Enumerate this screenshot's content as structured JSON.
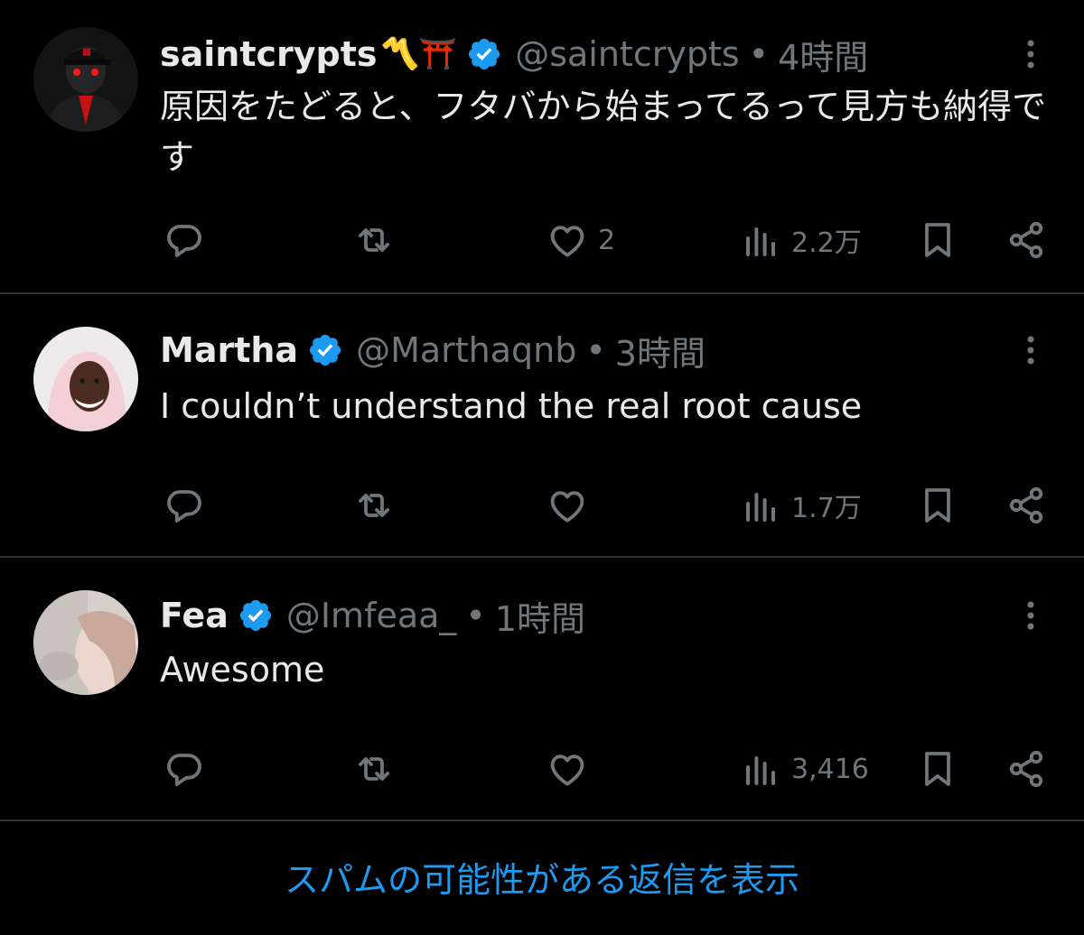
{
  "colors": {
    "background": "#000000",
    "text": "#e7e9ea",
    "muted": "#71767b",
    "accent": "#1d9bf0",
    "divider": "#2f3336"
  },
  "tweets": [
    {
      "name": "saintcrypts",
      "name_emoji": "〽️⛩️",
      "handle": "@saintcrypts",
      "separator": "•",
      "time": "4時間",
      "text": "原因をたどると、フタバから始まってるって見方も納得です",
      "likes": "2",
      "views": "2.2万",
      "avatar_icon": "avatar-dark-suit-red-eyes"
    },
    {
      "name": "Martha",
      "handle": "@Marthaqnb",
      "separator": "•",
      "time": "3時間",
      "text": "I couldn’t understand the real root cause",
      "likes": "",
      "views": "1.7万",
      "avatar_icon": "avatar-pink-hijab"
    },
    {
      "name": "Fea",
      "handle": "@Imfeaa_",
      "separator": "•",
      "time": "1時間",
      "text": "Awesome",
      "likes": "",
      "views": "3,416",
      "avatar_icon": "avatar-blurred-photo"
    }
  ],
  "show_spam_label": "スパムの可能性がある返信を表示"
}
